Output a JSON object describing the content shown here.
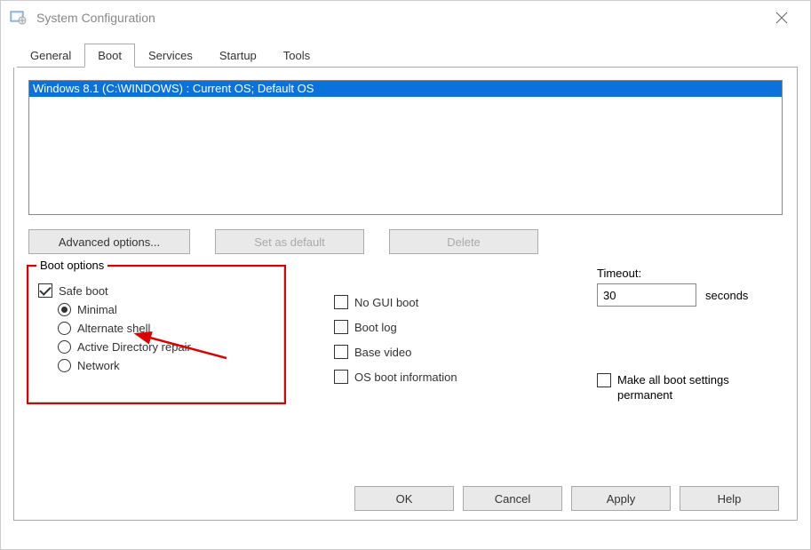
{
  "window": {
    "title": "System Configuration"
  },
  "tabs": [
    {
      "label": "General"
    },
    {
      "label": "Boot"
    },
    {
      "label": "Services"
    },
    {
      "label": "Startup"
    },
    {
      "label": "Tools"
    }
  ],
  "os_list": {
    "entry": "Windows 8.1 (C:\\WINDOWS) : Current OS; Default OS"
  },
  "buttons": {
    "advanced": "Advanced options...",
    "set_default": "Set as default",
    "delete": "Delete",
    "ok": "OK",
    "cancel": "Cancel",
    "apply": "Apply",
    "help": "Help"
  },
  "boot_options": {
    "legend": "Boot options",
    "safe_boot": "Safe boot",
    "minimal": "Minimal",
    "alt_shell": "Alternate shell",
    "ad_repair": "Active Directory repair",
    "network": "Network"
  },
  "extra_options": {
    "no_gui": "No GUI boot",
    "boot_log": "Boot log",
    "base_video": "Base video",
    "os_info": "OS boot information"
  },
  "timeout": {
    "label": "Timeout:",
    "value": "30",
    "unit": "seconds"
  },
  "permanent": {
    "label": "Make all boot settings permanent"
  }
}
